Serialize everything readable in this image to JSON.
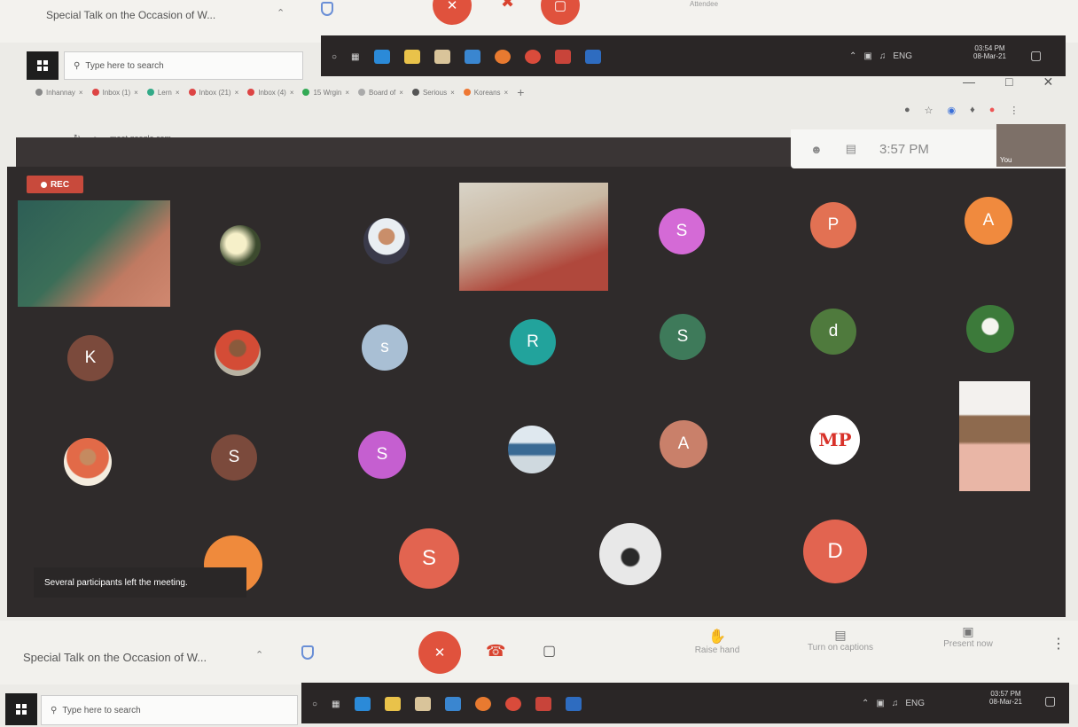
{
  "top_meet": {
    "title": "Special Talk on the Occasion of W...",
    "sub_text": "Attendee"
  },
  "top_taskbar": {
    "search": "Type here to search",
    "lang": "ENG",
    "time": "03:54 PM",
    "date": "08-Mar-21"
  },
  "browser": {
    "tabs": [
      "Inhannay",
      "Inbox (1)",
      "Lern",
      "Inbox (21)",
      "Inbox (4)",
      "15 Wrgin",
      "Board of",
      "Serious",
      "Koreans"
    ],
    "url": "meet.google.com"
  },
  "meeting": {
    "clock": "3:57 PM",
    "rec_label": "REC",
    "self_label": "You",
    "toast": "Several participants left the meeting.",
    "tiles": [
      {
        "letter": "S",
        "color": "#d46ad6"
      },
      {
        "letter": "P",
        "color": "#e27153"
      },
      {
        "letter": "A",
        "color": "#f08a3e"
      },
      {
        "letter": "K",
        "color": "#7b4a3c"
      },
      {
        "letter": "s",
        "color": "#a9bfd4"
      },
      {
        "letter": "R",
        "color": "#22a39c"
      },
      {
        "letter": "S",
        "color": "#3e7a5a"
      },
      {
        "letter": "d",
        "color": "#4f7a3d"
      },
      {
        "letter": "S",
        "color": "#7b4a3c"
      },
      {
        "letter": "S",
        "color": "#c55fd0"
      },
      {
        "letter": "A",
        "color": "#c9806a"
      },
      {
        "letter": "MP",
        "color": "#ffffff"
      },
      {
        "letter": "S",
        "color": "#e26450"
      },
      {
        "letter": "D",
        "color": "#e26450"
      }
    ]
  },
  "bottom_meet": {
    "title": "Special Talk on the Occasion of W...",
    "raise_hand": "Raise hand",
    "captions": "Turn on captions",
    "present": "Present now"
  },
  "bottom_taskbar": {
    "search": "Type here to search",
    "lang": "ENG",
    "time": "03:57 PM",
    "date": "08-Mar-21"
  }
}
